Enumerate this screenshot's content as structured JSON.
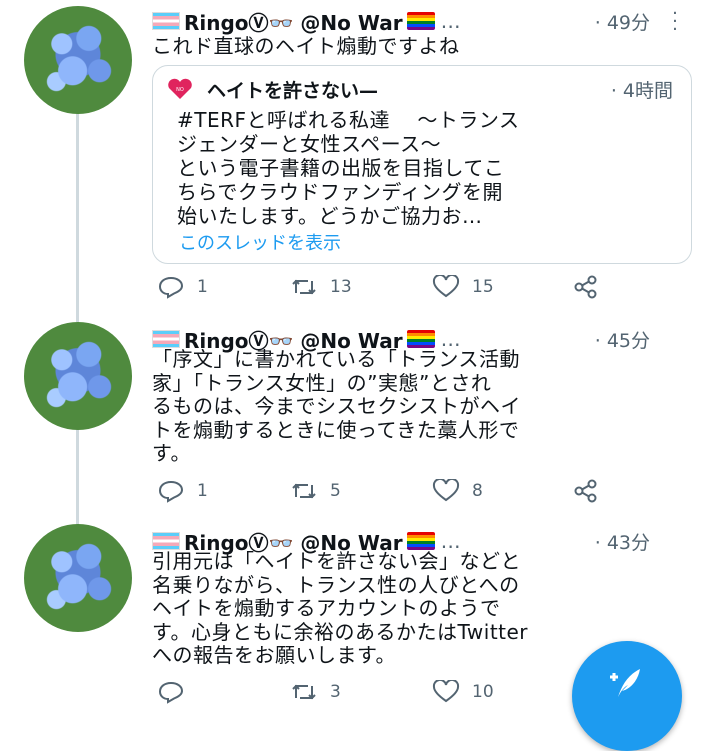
{
  "tweets": [
    {
      "display_name": "RingoⓋ👓 @No War",
      "time": "· 49分",
      "text": "これド直球のヘイト煽動ですよね",
      "quote": {
        "name": "ヘイトを許さない—",
        "time": "· 4時間",
        "line1": "#TERFと呼ばれる私達　 ～トランス",
        "line2": "ジェンダーと女性スペース～",
        "line3": "という電子書籍の出版を目指してこ",
        "line4": "ちらでクラウドファンディングを開",
        "line5": "始いたします。どうかご協力お…",
        "show_thread": "このスレッドを表示"
      },
      "replies": "1",
      "retweets": "13",
      "likes": "15"
    },
    {
      "display_name": "RingoⓋ👓 @No War",
      "time": "· 45分",
      "lines": [
        "「序文」に書かれている「トランス活動",
        "家」「トランス女性」の”実態”とされ",
        "るものは、今までシスセクシストがヘイ",
        "トを煽動するときに使ってきた藁人形で",
        "す。"
      ],
      "replies": "1",
      "retweets": "5",
      "likes": "8"
    },
    {
      "display_name": "RingoⓋ👓 @No War",
      "time": "· 43分",
      "lines": [
        "引用元は「ヘイトを許さない会」などと",
        "名乗りながら、トランス性の人びとへの",
        "ヘイトを煽動するアカウントのようで",
        "す。心身ともに余裕のあるかたはTwitter",
        "への報告をお願いします。"
      ],
      "replies": "",
      "retweets": "3",
      "likes": "10"
    }
  ],
  "colors": {
    "accent": "#1d9bf0",
    "muted": "#536471",
    "border": "#cfd9de",
    "heart_logo": "#e0245e"
  },
  "icons": [
    "reply-icon",
    "retweet-icon",
    "like-icon",
    "share-icon",
    "more-icon",
    "compose-icon",
    "no-hate-heart-icon"
  ]
}
